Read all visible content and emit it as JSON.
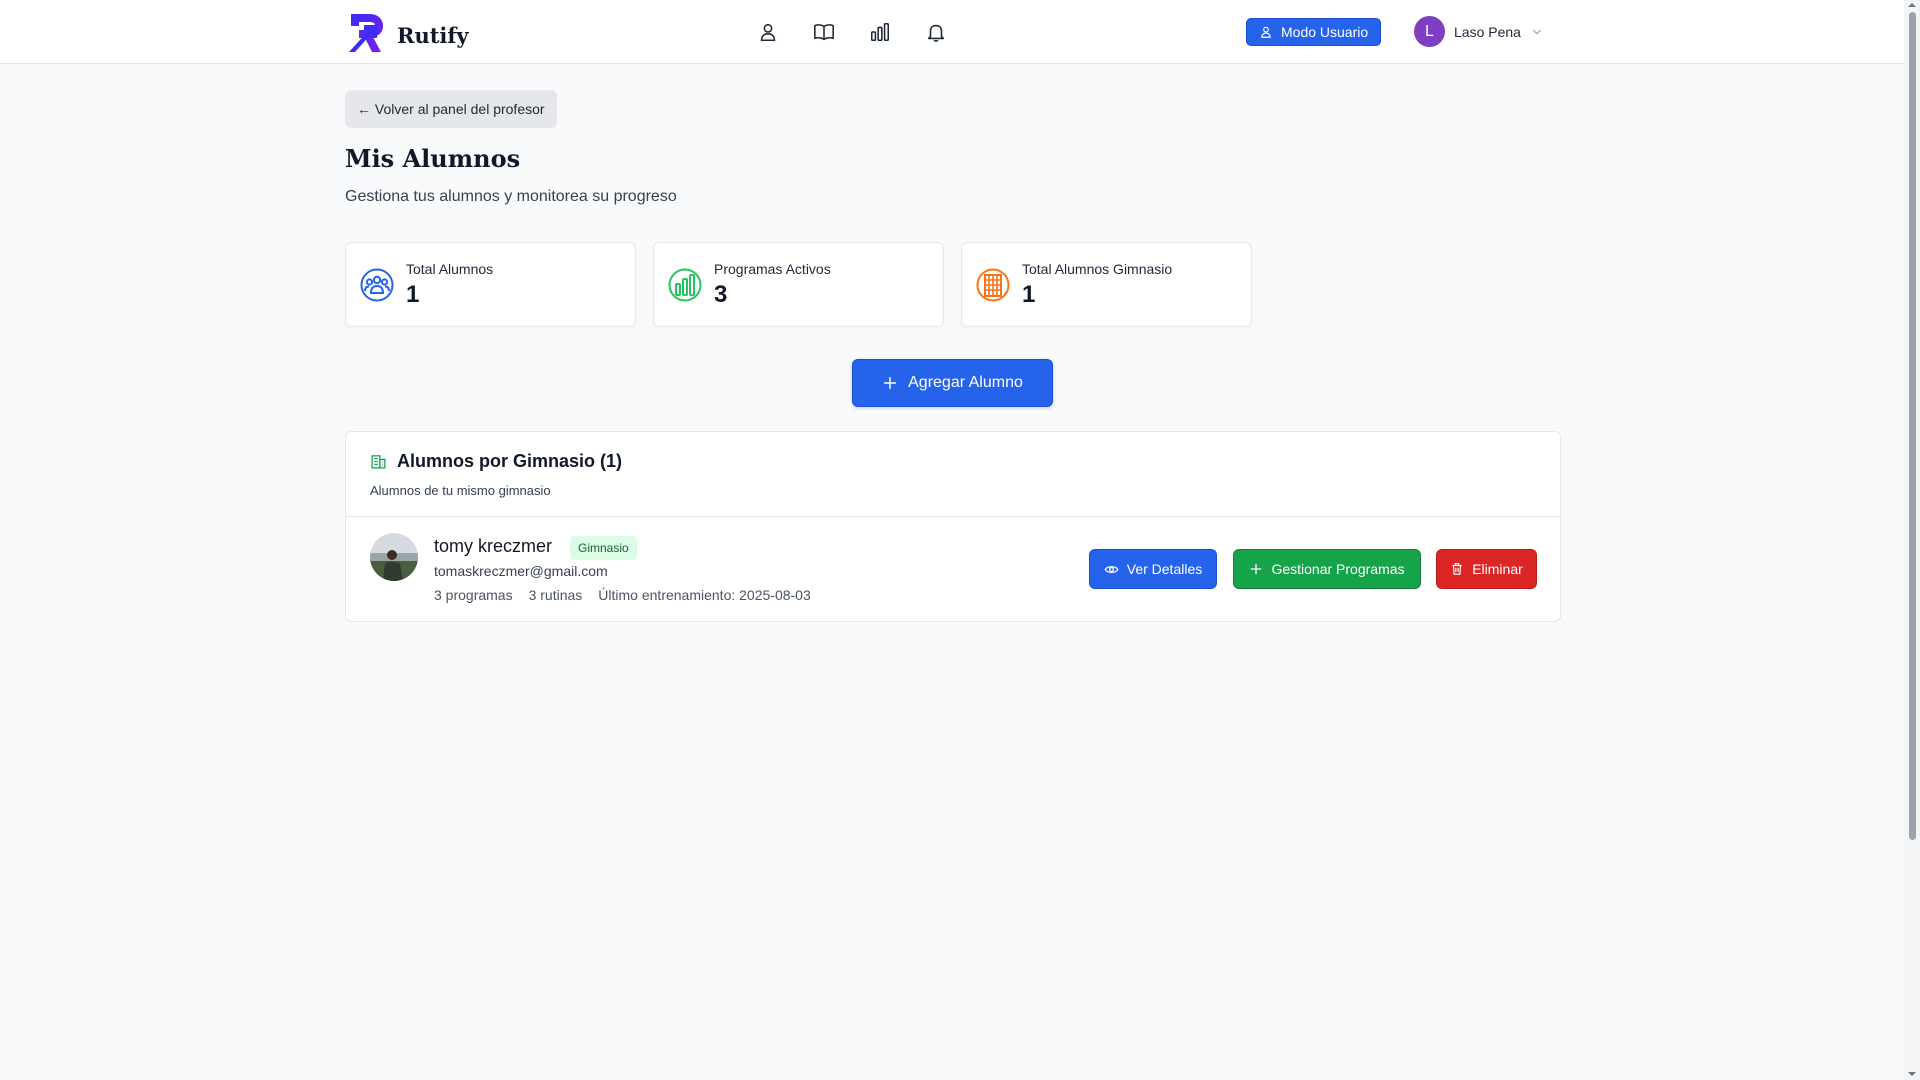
{
  "app": {
    "name": "Rutify"
  },
  "nav": {
    "icons": [
      "user-icon",
      "book-icon",
      "bar-chart-icon",
      "bell-icon"
    ],
    "mode_button": "Modo Usuario",
    "user_initial": "L",
    "user_name": "Laso Pena"
  },
  "page": {
    "back_label": "← Volver al panel del profesor",
    "title": "Mis Alumnos",
    "subtitle": "Gestiona tus alumnos y monitorea su progreso"
  },
  "stats": [
    {
      "label": "Total Alumnos",
      "value": "1",
      "icon": "users-icon",
      "color": "#2563eb"
    },
    {
      "label": "Programas Activos",
      "value": "3",
      "icon": "bar-chart-icon",
      "color": "#22c55e"
    },
    {
      "label": "Total Alumnos Gimnasio",
      "value": "1",
      "icon": "building-icon",
      "color": "#f97316"
    }
  ],
  "add_button": "Agregar Alumno",
  "section": {
    "title": "Alumnos por Gimnasio (1)",
    "description": "Alumnos de tu mismo gimnasio"
  },
  "students": [
    {
      "name": "tomy kreczmer",
      "badge": "Gimnasio",
      "email": "tomaskreczmer@gmail.com",
      "programs": "3 programas",
      "routines": "3 rutinas",
      "last_training": "Último entrenamiento: 2025-08-03",
      "actions": {
        "details": "Ver Detalles",
        "manage": "Gestionar Programas",
        "delete": "Eliminar"
      }
    }
  ],
  "colors": {
    "primary": "#2563eb",
    "success": "#16a34a",
    "danger": "#dc2626",
    "brand_purple": "#7e3fc2"
  }
}
